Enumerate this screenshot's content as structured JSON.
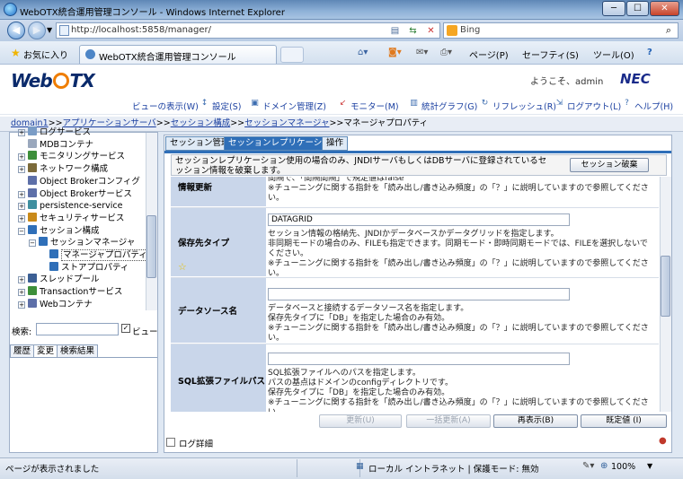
{
  "window": {
    "title": "WebOTX統合運用管理コンソール - Windows Internet Explorer",
    "btn_min": "─",
    "btn_max": "☐",
    "btn_close": "✕"
  },
  "address": {
    "url": "http://localhost:5858/manager/",
    "search_placeholder": "Bing"
  },
  "ie_toolbar": {
    "favorites": "お気に入り",
    "tab_title": "WebOTX統合運用管理コンソール",
    "page": "ページ(P)",
    "safety": "セーフティ(S)",
    "tools": "ツール(O)",
    "help": "?"
  },
  "app": {
    "logo_left": "Web",
    "logo_right": "TX",
    "welcome": "ようこそ、admin",
    "brand": "NEC",
    "menu": [
      "ビューの表示(W)",
      "設定(S)",
      "ドメイン管理(Z)",
      "モニター(M)",
      "統計グラフ(G)",
      "リフレッシュ(R)",
      "ログアウト(L)",
      "ヘルプ(H)"
    ]
  },
  "breadcrumb": {
    "items": [
      "domain1",
      "アプリケーションサーバ",
      "セッション構成",
      "セッションマネージャ"
    ],
    "sep": ">>",
    "current": "マネージャプロパティ"
  },
  "tree": [
    {
      "label": "ログサービス",
      "depth": 1,
      "exp": "+",
      "color": "#7a9cc6"
    },
    {
      "label": "MDBコンテナ",
      "depth": 1,
      "exp": "",
      "color": "#9aa8bd"
    },
    {
      "label": "モニタリングサービス",
      "depth": 1,
      "exp": "+",
      "color": "#3d8f3a"
    },
    {
      "label": "ネットワーク構成",
      "depth": 1,
      "exp": "+",
      "color": "#7b6a3a"
    },
    {
      "label": "Object Brokerコンフィグ",
      "depth": 1,
      "exp": "",
      "color": "#5d6fa8"
    },
    {
      "label": "Object Brokerサービス",
      "depth": 1,
      "exp": "+",
      "color": "#5d6fa8"
    },
    {
      "label": "persistence-service",
      "depth": 1,
      "exp": "+",
      "color": "#3f8f9f"
    },
    {
      "label": "セキュリティサービス",
      "depth": 1,
      "exp": "+",
      "color": "#c98a1a"
    },
    {
      "label": "セッション構成",
      "depth": 1,
      "exp": "−",
      "color": "#2f6fb8"
    },
    {
      "label": "セッションマネージャ",
      "depth": 2,
      "exp": "−",
      "color": "#2f6fb8"
    },
    {
      "label": "マネージャプロパティ",
      "depth": 3,
      "exp": "",
      "color": "#2f6fb8",
      "selected": true
    },
    {
      "label": "ストアプロパティ",
      "depth": 3,
      "exp": "",
      "color": "#2f6fb8"
    },
    {
      "label": "スレッドプール",
      "depth": 1,
      "exp": "+",
      "color": "#3b5f94"
    },
    {
      "label": "Transactionサービス",
      "depth": 1,
      "exp": "+",
      "color": "#3d8f3a"
    },
    {
      "label": "Webコンテナ",
      "depth": 1,
      "exp": "+",
      "color": "#5d6fa8"
    }
  ],
  "left": {
    "search_label": "検索:",
    "view_check": "✓",
    "view_label": "ビュー",
    "tabs": [
      "履歴",
      "変更",
      "検索結果"
    ]
  },
  "main": {
    "tabs": [
      "セッション管理",
      "セッションレプリケーション",
      "操作"
    ],
    "notice": "セッションレプリケーション使用の場合のみ、JNDIサーバもしくはDBサーバに登録されているセッション情報を破棄します。",
    "discard_button": "セッション破棄",
    "props": [
      {
        "label": "情報更新",
        "value": "",
        "desc": [
          "間隔で、「間隔間隔」で規定値はfalse",
          "※チューニングに関する指針を「読み出し/書き込み頻度」の「？」に説明していますので参照してください。"
        ]
      },
      {
        "label": "保存先タイプ",
        "value": "DATAGRID",
        "desc": [
          "セッション情報の格納先、JNDIかデータベースかデータグリッドを指定します。",
          "非同期モードの場合のみ、FILEも指定できます。同期モード・即時同期モードでは、FILEを選択しないでください。",
          "※チューニングに関する指針を「読み出し/書き込み頻度」の「？」に説明していますので参照してください。"
        ]
      },
      {
        "label": "データソース名",
        "value": "",
        "desc": [
          "データベースと接続するデータソース名を指定します。",
          "保存先タイプに「DB」を指定した場合のみ有効。",
          "※チューニングに関する指針を「読み出し/書き込み頻度」の「？」に説明していますので参照してください。"
        ]
      },
      {
        "label": "SQL拡張ファイルパス",
        "value": "",
        "desc": [
          "SQL拡張ファイルへのパスを指定します。",
          "パスの基点はドメインのconfigディレクトリです。",
          "保存先タイプに「DB」を指定した場合のみ有効。",
          "※チューニングに関する指針を「読み出し/書き込み頻度」の「？」に説明していますので参照してください。"
        ]
      }
    ],
    "buttons": {
      "update": "更新(U)",
      "bulk_update": "一括更新(A)",
      "redisplay": "再表示(B)",
      "default": "既定値 (I)"
    },
    "log_label": "ログ詳細"
  },
  "status": {
    "text": "ページが表示されました",
    "zone": "ローカル イントラネット | 保護モード: 無効",
    "zoom": "100%"
  }
}
